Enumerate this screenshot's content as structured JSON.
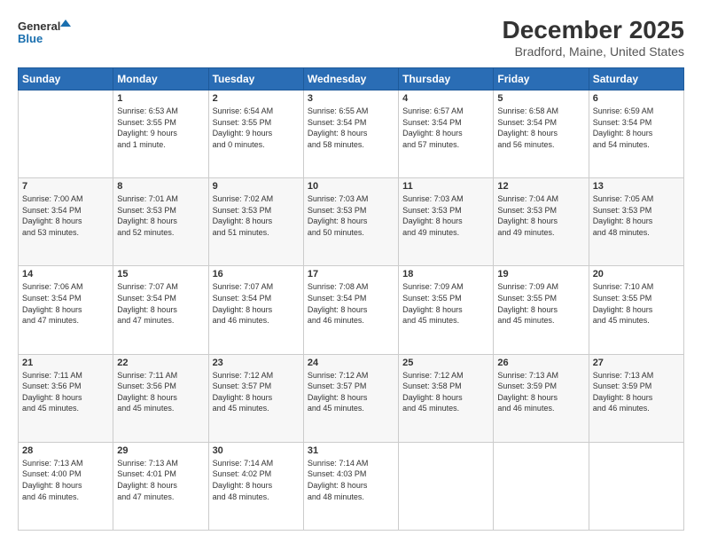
{
  "header": {
    "logo_line1": "General",
    "logo_line2": "Blue",
    "title": "December 2025",
    "subtitle": "Bradford, Maine, United States"
  },
  "calendar": {
    "days_of_week": [
      "Sunday",
      "Monday",
      "Tuesday",
      "Wednesday",
      "Thursday",
      "Friday",
      "Saturday"
    ],
    "weeks": [
      [
        {
          "day": "",
          "info": ""
        },
        {
          "day": "1",
          "info": "Sunrise: 6:53 AM\nSunset: 3:55 PM\nDaylight: 9 hours\nand 1 minute."
        },
        {
          "day": "2",
          "info": "Sunrise: 6:54 AM\nSunset: 3:55 PM\nDaylight: 9 hours\nand 0 minutes."
        },
        {
          "day": "3",
          "info": "Sunrise: 6:55 AM\nSunset: 3:54 PM\nDaylight: 8 hours\nand 58 minutes."
        },
        {
          "day": "4",
          "info": "Sunrise: 6:57 AM\nSunset: 3:54 PM\nDaylight: 8 hours\nand 57 minutes."
        },
        {
          "day": "5",
          "info": "Sunrise: 6:58 AM\nSunset: 3:54 PM\nDaylight: 8 hours\nand 56 minutes."
        },
        {
          "day": "6",
          "info": "Sunrise: 6:59 AM\nSunset: 3:54 PM\nDaylight: 8 hours\nand 54 minutes."
        }
      ],
      [
        {
          "day": "7",
          "info": "Sunrise: 7:00 AM\nSunset: 3:54 PM\nDaylight: 8 hours\nand 53 minutes."
        },
        {
          "day": "8",
          "info": "Sunrise: 7:01 AM\nSunset: 3:53 PM\nDaylight: 8 hours\nand 52 minutes."
        },
        {
          "day": "9",
          "info": "Sunrise: 7:02 AM\nSunset: 3:53 PM\nDaylight: 8 hours\nand 51 minutes."
        },
        {
          "day": "10",
          "info": "Sunrise: 7:03 AM\nSunset: 3:53 PM\nDaylight: 8 hours\nand 50 minutes."
        },
        {
          "day": "11",
          "info": "Sunrise: 7:03 AM\nSunset: 3:53 PM\nDaylight: 8 hours\nand 49 minutes."
        },
        {
          "day": "12",
          "info": "Sunrise: 7:04 AM\nSunset: 3:53 PM\nDaylight: 8 hours\nand 49 minutes."
        },
        {
          "day": "13",
          "info": "Sunrise: 7:05 AM\nSunset: 3:53 PM\nDaylight: 8 hours\nand 48 minutes."
        }
      ],
      [
        {
          "day": "14",
          "info": "Sunrise: 7:06 AM\nSunset: 3:54 PM\nDaylight: 8 hours\nand 47 minutes."
        },
        {
          "day": "15",
          "info": "Sunrise: 7:07 AM\nSunset: 3:54 PM\nDaylight: 8 hours\nand 47 minutes."
        },
        {
          "day": "16",
          "info": "Sunrise: 7:07 AM\nSunset: 3:54 PM\nDaylight: 8 hours\nand 46 minutes."
        },
        {
          "day": "17",
          "info": "Sunrise: 7:08 AM\nSunset: 3:54 PM\nDaylight: 8 hours\nand 46 minutes."
        },
        {
          "day": "18",
          "info": "Sunrise: 7:09 AM\nSunset: 3:55 PM\nDaylight: 8 hours\nand 45 minutes."
        },
        {
          "day": "19",
          "info": "Sunrise: 7:09 AM\nSunset: 3:55 PM\nDaylight: 8 hours\nand 45 minutes."
        },
        {
          "day": "20",
          "info": "Sunrise: 7:10 AM\nSunset: 3:55 PM\nDaylight: 8 hours\nand 45 minutes."
        }
      ],
      [
        {
          "day": "21",
          "info": "Sunrise: 7:11 AM\nSunset: 3:56 PM\nDaylight: 8 hours\nand 45 minutes."
        },
        {
          "day": "22",
          "info": "Sunrise: 7:11 AM\nSunset: 3:56 PM\nDaylight: 8 hours\nand 45 minutes."
        },
        {
          "day": "23",
          "info": "Sunrise: 7:12 AM\nSunset: 3:57 PM\nDaylight: 8 hours\nand 45 minutes."
        },
        {
          "day": "24",
          "info": "Sunrise: 7:12 AM\nSunset: 3:57 PM\nDaylight: 8 hours\nand 45 minutes."
        },
        {
          "day": "25",
          "info": "Sunrise: 7:12 AM\nSunset: 3:58 PM\nDaylight: 8 hours\nand 45 minutes."
        },
        {
          "day": "26",
          "info": "Sunrise: 7:13 AM\nSunset: 3:59 PM\nDaylight: 8 hours\nand 46 minutes."
        },
        {
          "day": "27",
          "info": "Sunrise: 7:13 AM\nSunset: 3:59 PM\nDaylight: 8 hours\nand 46 minutes."
        }
      ],
      [
        {
          "day": "28",
          "info": "Sunrise: 7:13 AM\nSunset: 4:00 PM\nDaylight: 8 hours\nand 46 minutes."
        },
        {
          "day": "29",
          "info": "Sunrise: 7:13 AM\nSunset: 4:01 PM\nDaylight: 8 hours\nand 47 minutes."
        },
        {
          "day": "30",
          "info": "Sunrise: 7:14 AM\nSunset: 4:02 PM\nDaylight: 8 hours\nand 48 minutes."
        },
        {
          "day": "31",
          "info": "Sunrise: 7:14 AM\nSunset: 4:03 PM\nDaylight: 8 hours\nand 48 minutes."
        },
        {
          "day": "",
          "info": ""
        },
        {
          "day": "",
          "info": ""
        },
        {
          "day": "",
          "info": ""
        }
      ]
    ]
  }
}
